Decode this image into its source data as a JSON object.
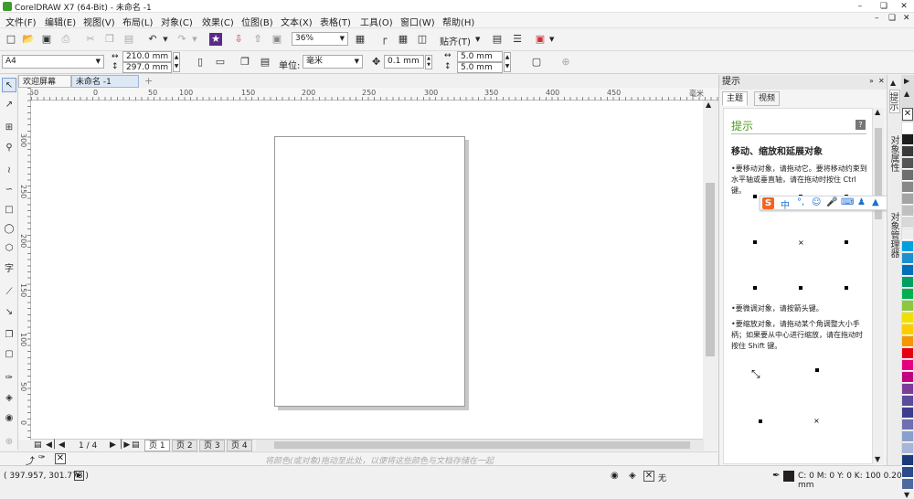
{
  "window": {
    "title": "CorelDRAW X7 (64-Bit) - 未命名 -1"
  },
  "menu": [
    "文件(F)",
    "编辑(E)",
    "视图(V)",
    "布局(L)",
    "对象(C)",
    "效果(C)",
    "位图(B)",
    "文本(X)",
    "表格(T)",
    "工具(O)",
    "窗口(W)",
    "帮助(H)"
  ],
  "toolbar": {
    "zoom": "36%",
    "snap_label": "贴齐(T)"
  },
  "propbar": {
    "page_size": "A4",
    "width": "210.0 mm",
    "height": "297.0 mm",
    "unit_label": "单位:",
    "unit": "毫米",
    "nudge": "0.1 mm",
    "dup_x": "5.0 mm",
    "dup_y": "5.0 mm"
  },
  "doc_tabs": [
    "欢迎屏幕",
    "未命名 -1"
  ],
  "ruler_h": [
    "50",
    "0",
    "50",
    "100",
    "150",
    "200",
    "250",
    "300",
    "350",
    "400",
    "450"
  ],
  "ruler_h_unit": "毫米",
  "ruler_v": [
    "300",
    "250",
    "200",
    "150",
    "100",
    "50",
    "0"
  ],
  "pagebar": {
    "page_count": "1 / 4",
    "pages": [
      "页 1",
      "页 2",
      "页 3",
      "页 4"
    ]
  },
  "palette_hint": "将颜色(或对象)拖动至此处，以便将这些颜色与文档存储在一起",
  "status": {
    "coords": "( 397.957, 301.778 )",
    "fill_label": "无",
    "outline": "C: 0 M: 0 Y: 0 K: 100  0.200 mm"
  },
  "docker": {
    "title": "提示",
    "tabs": [
      "主题",
      "视频"
    ],
    "heading": "提示",
    "subheading": "移动、缩放和延展对象",
    "bullets": [
      "要移动对象，请拖动它。要将移动约束到水平轴或垂直轴，请在拖动时按住 Ctrl 键。",
      "要微调对象，请按箭头键。",
      "要缩放对象，请拖动某个角调整大小手柄；如果要从中心进行缩放，请在拖动时按住 Shift 键。"
    ]
  },
  "vertical_tabs": [
    "提示",
    "对象属性",
    "对象管理器"
  ],
  "ime": {
    "mode": "中"
  },
  "palette_colors": [
    "#ffffff",
    "#1c1c1c",
    "#3a3a3a",
    "#555555",
    "#6e6e6e",
    "#888888",
    "#a4a4a4",
    "#c0c0c0",
    "#d8d8d8",
    "#eeeeee",
    "#00a0e0",
    "#1d8fd0",
    "#0070b8",
    "#00a060",
    "#00b050",
    "#8dc63f",
    "#f0e000",
    "#ffcc00",
    "#f39800",
    "#e60012",
    "#e4007f",
    "#c0007f",
    "#7d3c98",
    "#5b4b9a",
    "#3d3d8f",
    "#6f6fb0",
    "#8aa0cc",
    "#a7b6d8",
    "#1a3a7a",
    "#2d4a8a",
    "#4d6aa0"
  ],
  "colors": {
    "accent": "#4b9b1f",
    "selected_tab": "#dde8f5"
  }
}
